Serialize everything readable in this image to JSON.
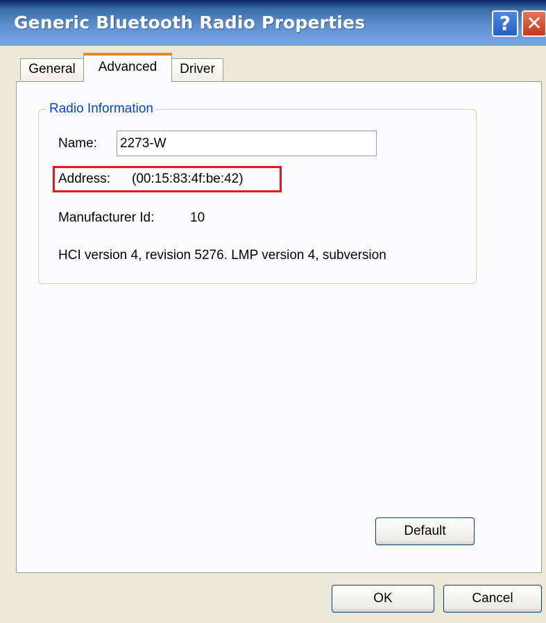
{
  "window": {
    "title": "Generic Bluetooth Radio Properties",
    "help_glyph": "?",
    "close_glyph": "✕"
  },
  "tabs": [
    {
      "label": "General",
      "selected": false
    },
    {
      "label": "Advanced",
      "selected": true
    },
    {
      "label": "Driver",
      "selected": false
    }
  ],
  "radio_info": {
    "group_label": "Radio Information",
    "name_label": "Name:",
    "name_value": "2273-W",
    "address_label": "Address:",
    "address_value": "(00:15:83:4f:be:42)",
    "manufacturer_label": "Manufacturer Id:",
    "manufacturer_value": "10",
    "version_text": "HCI version 4, revision 5276.  LMP version 4, subversion"
  },
  "buttons": {
    "default_label": "Default",
    "ok_label": "OK",
    "cancel_label": "Cancel"
  },
  "colors": {
    "highlight_box": "#e8141c",
    "group_label": "#0046d5",
    "title_bar": "#3a6ea5"
  }
}
